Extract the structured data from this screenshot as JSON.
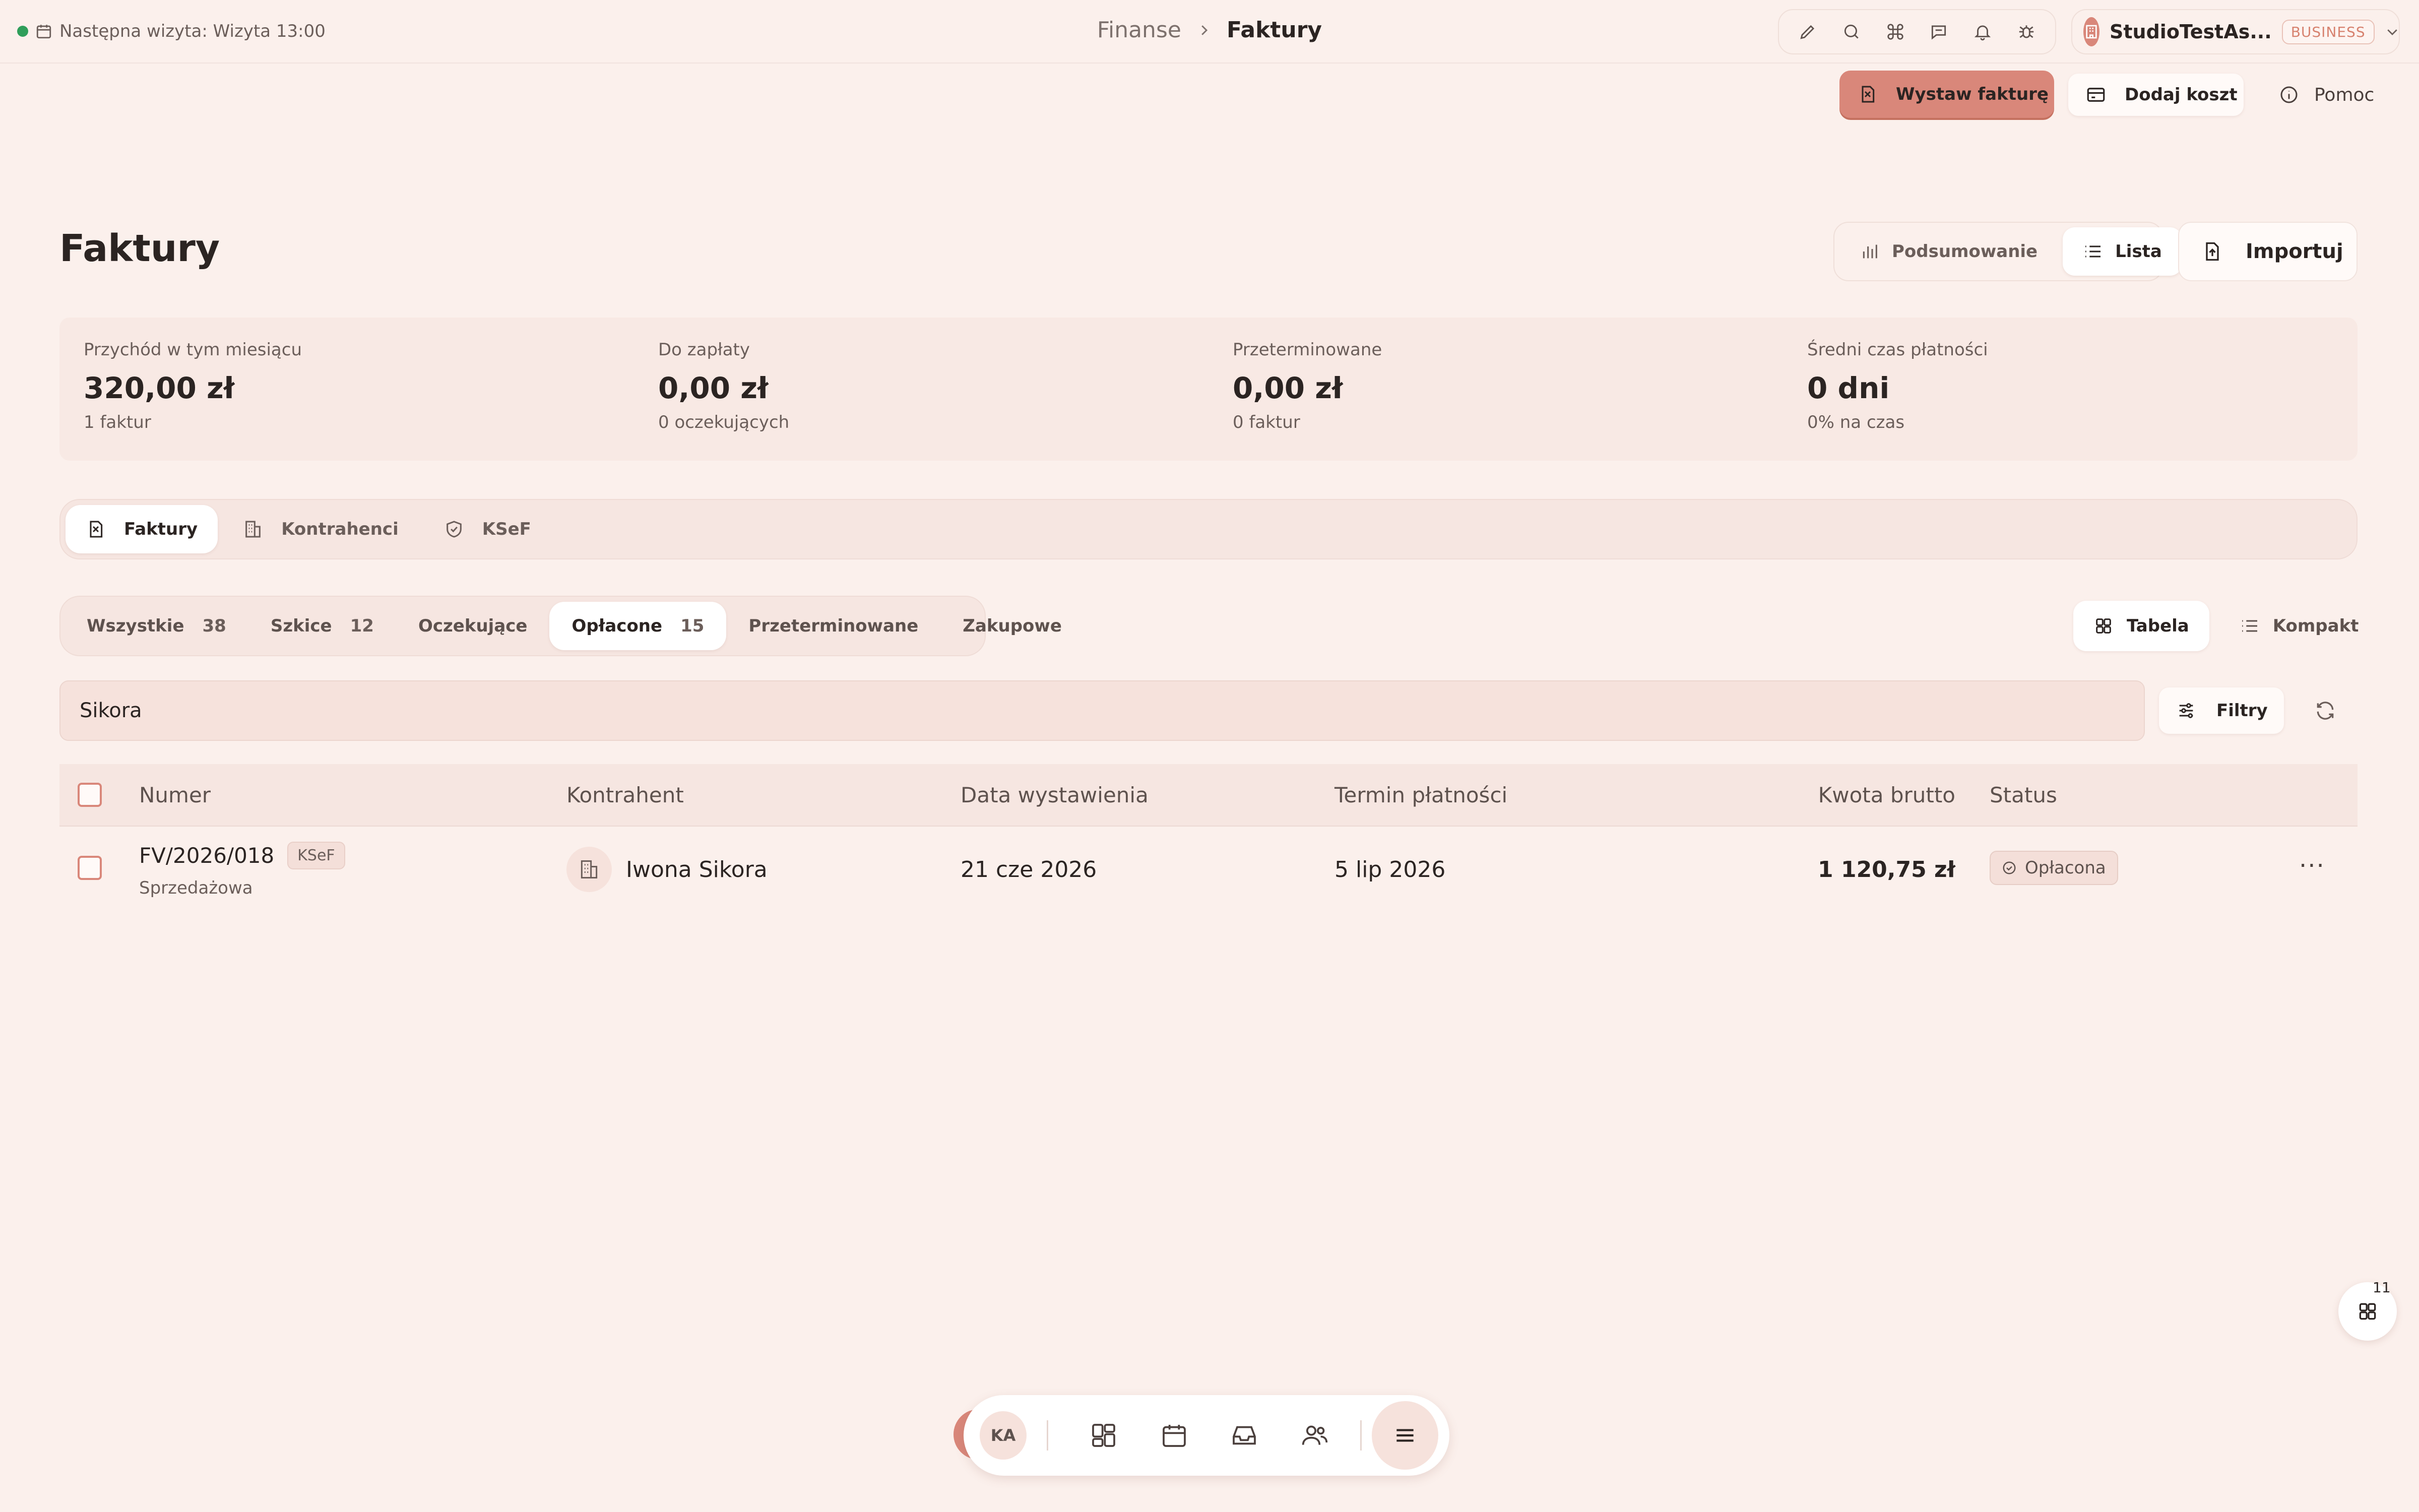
{
  "topbar": {
    "next_visit": "Następna wizyta: Wizyta 13:00",
    "breadcrumb_parent": "Finanse",
    "breadcrumb_current": "Faktury",
    "account_name": "StudioTestAs...",
    "account_plan": "BUSINESS"
  },
  "actions": {
    "issue_invoice": "Wystaw fakturę",
    "add_cost": "Dodaj koszt",
    "help": "Pomoc"
  },
  "page": {
    "title": "Faktury",
    "view_summary": "Podsumowanie",
    "view_list": "Lista",
    "import": "Importuj"
  },
  "stats": [
    {
      "label": "Przychód w tym miesiącu",
      "value": "320,00 zł",
      "sub": "1 faktur"
    },
    {
      "label": "Do zapłaty",
      "value": "0,00 zł",
      "sub": "0 oczekujących"
    },
    {
      "label": "Przeterminowane",
      "value": "0,00 zł",
      "sub": "0 faktur"
    },
    {
      "label": "Średni czas płatności",
      "value": "0 dni",
      "sub": "0% na czas"
    }
  ],
  "section_tabs": [
    "Faktury",
    "Kontrahenci",
    "KSeF"
  ],
  "filters": {
    "chips": [
      {
        "label": "Wszystkie",
        "count": "38"
      },
      {
        "label": "Szkice",
        "count": "12"
      },
      {
        "label": "Oczekujące",
        "count": ""
      },
      {
        "label": "Opłacone",
        "count": "15"
      },
      {
        "label": "Przeterminowane",
        "count": ""
      },
      {
        "label": "Zakupowe",
        "count": ""
      }
    ],
    "layout_table": "Tabela",
    "layout_compact": "Kompakt",
    "filters_button": "Filtry"
  },
  "search": {
    "value": "Sikora"
  },
  "table": {
    "columns": [
      "Numer",
      "Kontrahent",
      "Data wystawienia",
      "Termin płatności",
      "Kwota brutto",
      "Status"
    ],
    "rows": [
      {
        "number": "FV/2026/018",
        "badge": "KSeF",
        "type": "Sprzedażowa",
        "contractor": "Iwona Sikora",
        "issue_date": "21 cze 2026",
        "due_date": "5 lip 2026",
        "amount": "1 120,75 zł",
        "status": "Opłacona"
      }
    ]
  },
  "dock": {
    "avatar_initials": "KA"
  },
  "widget": {
    "badge_count": "11"
  },
  "colors": {
    "background": "#fbf0ec",
    "accent": "#d9877a",
    "status_ok": "#2f9e5a"
  }
}
